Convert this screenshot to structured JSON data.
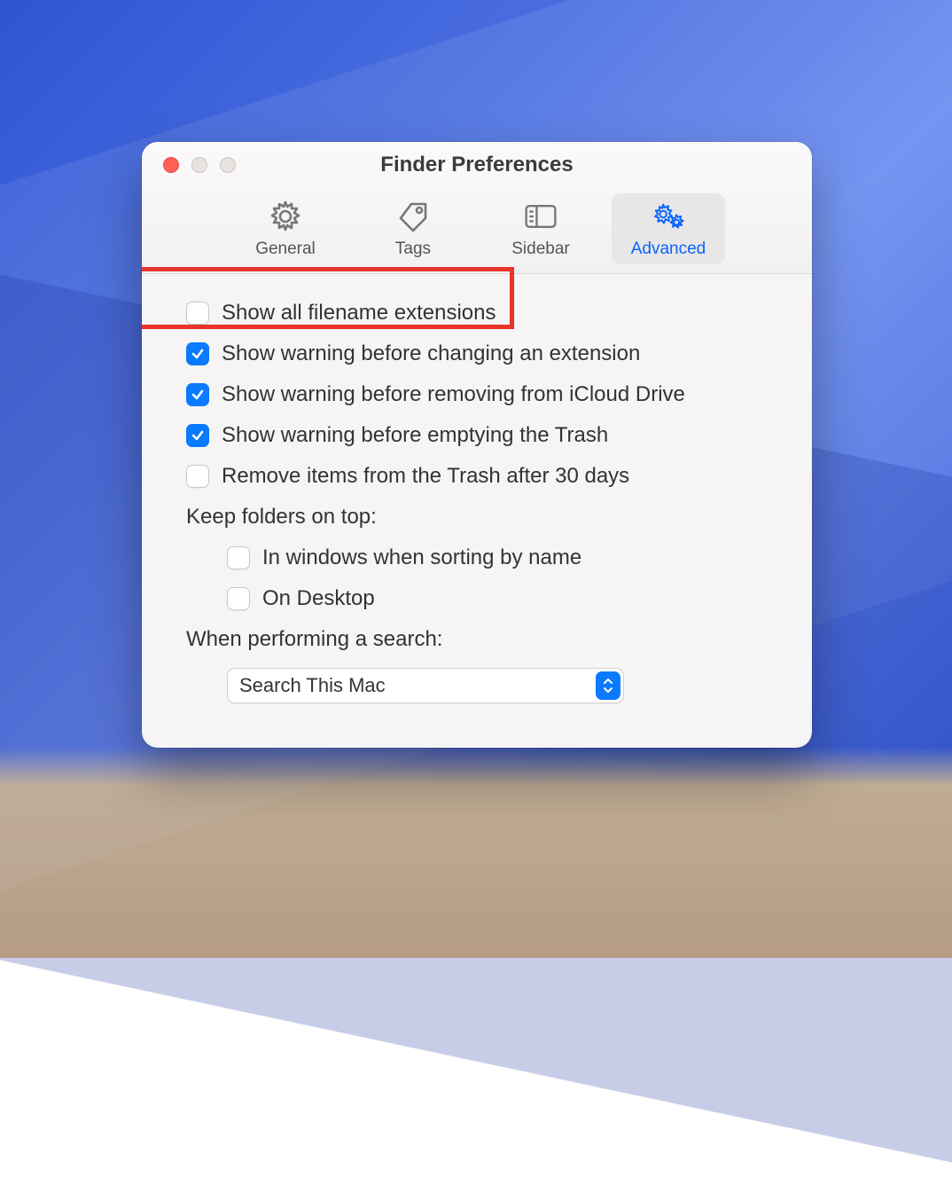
{
  "window": {
    "title": "Finder Preferences"
  },
  "tabs": [
    {
      "id": "general",
      "label": "General",
      "active": false
    },
    {
      "id": "tags",
      "label": "Tags",
      "active": false
    },
    {
      "id": "sidebar",
      "label": "Sidebar",
      "active": false
    },
    {
      "id": "advanced",
      "label": "Advanced",
      "active": true
    }
  ],
  "options": {
    "show_extensions": {
      "label": "Show all filename extensions",
      "checked": false,
      "highlighted": true
    },
    "warn_change_ext": {
      "label": "Show warning before changing an extension",
      "checked": true
    },
    "warn_remove_icloud": {
      "label": "Show warning before removing from iCloud Drive",
      "checked": true
    },
    "warn_empty_trash": {
      "label": "Show warning before emptying the Trash",
      "checked": true
    },
    "remove_trash_30": {
      "label": "Remove items from the Trash after 30 days",
      "checked": false
    }
  },
  "keep_on_top": {
    "label": "Keep folders on top:",
    "in_windows": {
      "label": "In windows when sorting by name",
      "checked": false
    },
    "on_desktop": {
      "label": "On Desktop",
      "checked": false
    }
  },
  "search": {
    "label": "When performing a search:",
    "selected": "Search This Mac"
  },
  "colors": {
    "accent": "#0a7aff",
    "highlight": "#e7352c"
  }
}
